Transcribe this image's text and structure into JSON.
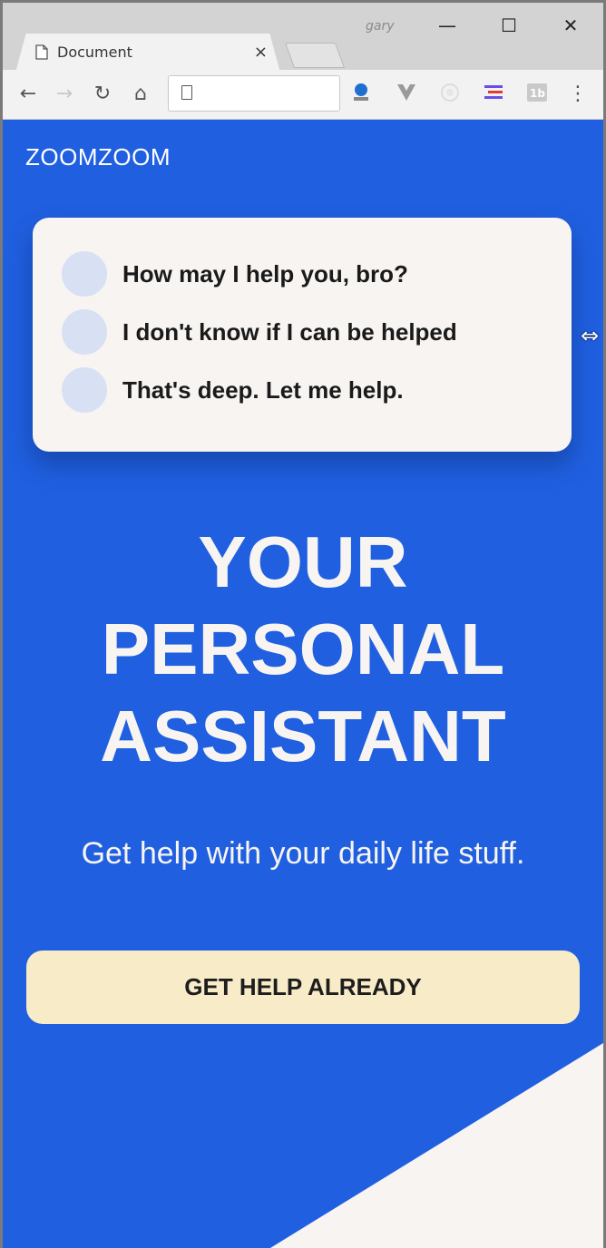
{
  "browser": {
    "tab_title": "Document",
    "tab_close": "×",
    "profile_name": "gary",
    "controls": {
      "minimize": "—",
      "maximize": "☐",
      "close": "✕"
    },
    "nav": {
      "back": "←",
      "forward": "→",
      "reload": "↻",
      "home": "⌂"
    },
    "url": "",
    "menu": "⋮",
    "extensions": [
      "bookmark-manager-icon",
      "vue-devtools-icon",
      "camera-icon",
      "menu-lines-icon",
      "1b-extension-icon"
    ]
  },
  "page": {
    "logo": "ZOOMZOOM",
    "chat": [
      {
        "text": "How may I help you, bro?"
      },
      {
        "text": "I don't know if I can be helped"
      },
      {
        "text": "That's deep. Let me help."
      }
    ],
    "headline": [
      "YOUR",
      "PERSONAL",
      "ASSISTANT"
    ],
    "subheading": "Get help with your daily life stuff.",
    "cta_label": "GET HELP ALREADY"
  },
  "colors": {
    "primary": "#1f5fe0",
    "card": "#f7f4f2",
    "avatar": "#d8e0f3",
    "cta": "#f8ebc7",
    "text_light": "#f7f4f2",
    "text_dark": "#1a1a1a"
  }
}
